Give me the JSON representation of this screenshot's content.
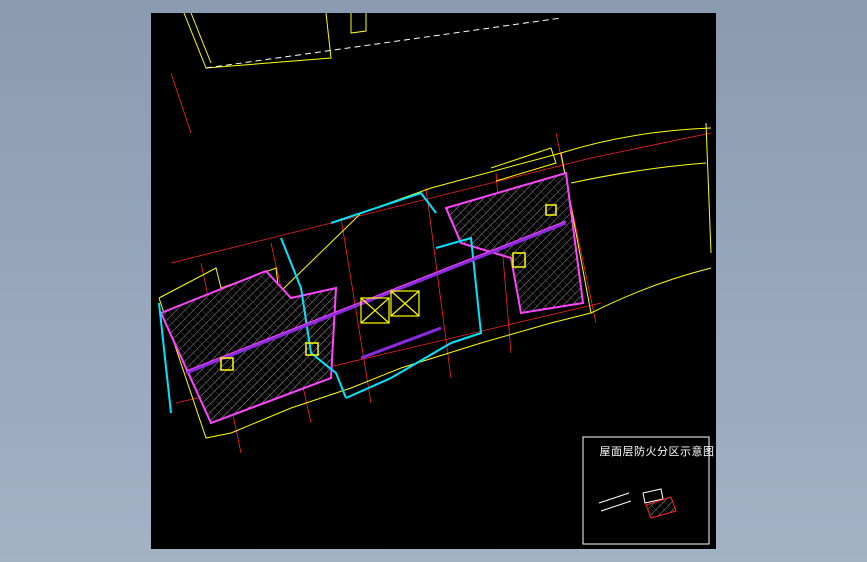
{
  "drawing": {
    "background_color": "#000000",
    "legend": {
      "title": "屋面层防火分区示意图",
      "note_line_1": "",
      "note_line_2": ""
    }
  },
  "colors": {
    "outline": "#ffff00",
    "zone_border": "#ff44ff",
    "cyan_wall": "#00e5ff",
    "grid_red": "#ff2222",
    "corridor": "#8a2be2",
    "hatch": "#bbbbbb"
  }
}
